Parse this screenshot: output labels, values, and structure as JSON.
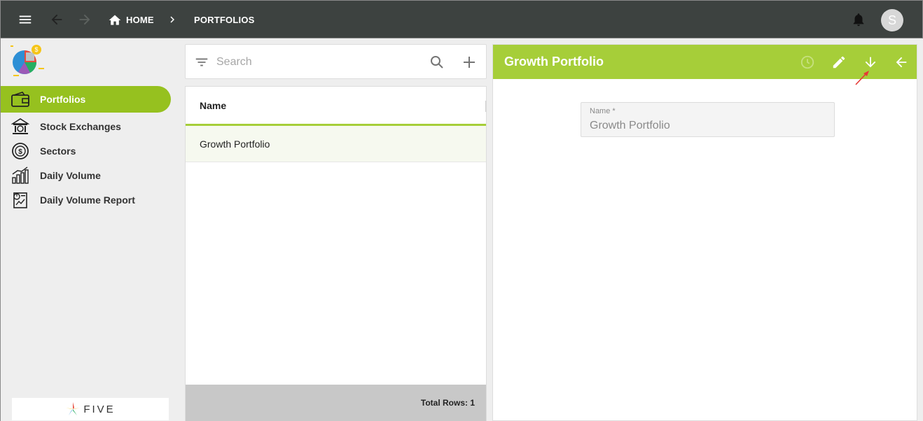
{
  "topbar": {
    "home_label": "HOME",
    "current_label": "PORTFOLIOS",
    "avatar_initial": "S"
  },
  "sidebar": {
    "items": [
      {
        "label": "Portfolios",
        "icon": "wallet-icon",
        "active": true
      },
      {
        "label": "Stock Exchanges",
        "icon": "bank-icon"
      },
      {
        "label": "Sectors",
        "icon": "dollar-circle-icon"
      },
      {
        "label": "Daily Volume",
        "icon": "bar-chart-icon"
      },
      {
        "label": "Daily Volume Report",
        "icon": "report-icon"
      }
    ],
    "brand": "FIVE"
  },
  "list": {
    "search_placeholder": "Search",
    "column_header": "Name",
    "rows": [
      "Growth Portfolio"
    ],
    "footer": "Total Rows: 1"
  },
  "detail": {
    "title": "Growth Portfolio",
    "field_label": "Name *",
    "field_value": "Growth Portfolio"
  },
  "colors": {
    "topbar": "#3d4240",
    "accent": "#a6ce39",
    "active_nav": "#96c11f"
  }
}
